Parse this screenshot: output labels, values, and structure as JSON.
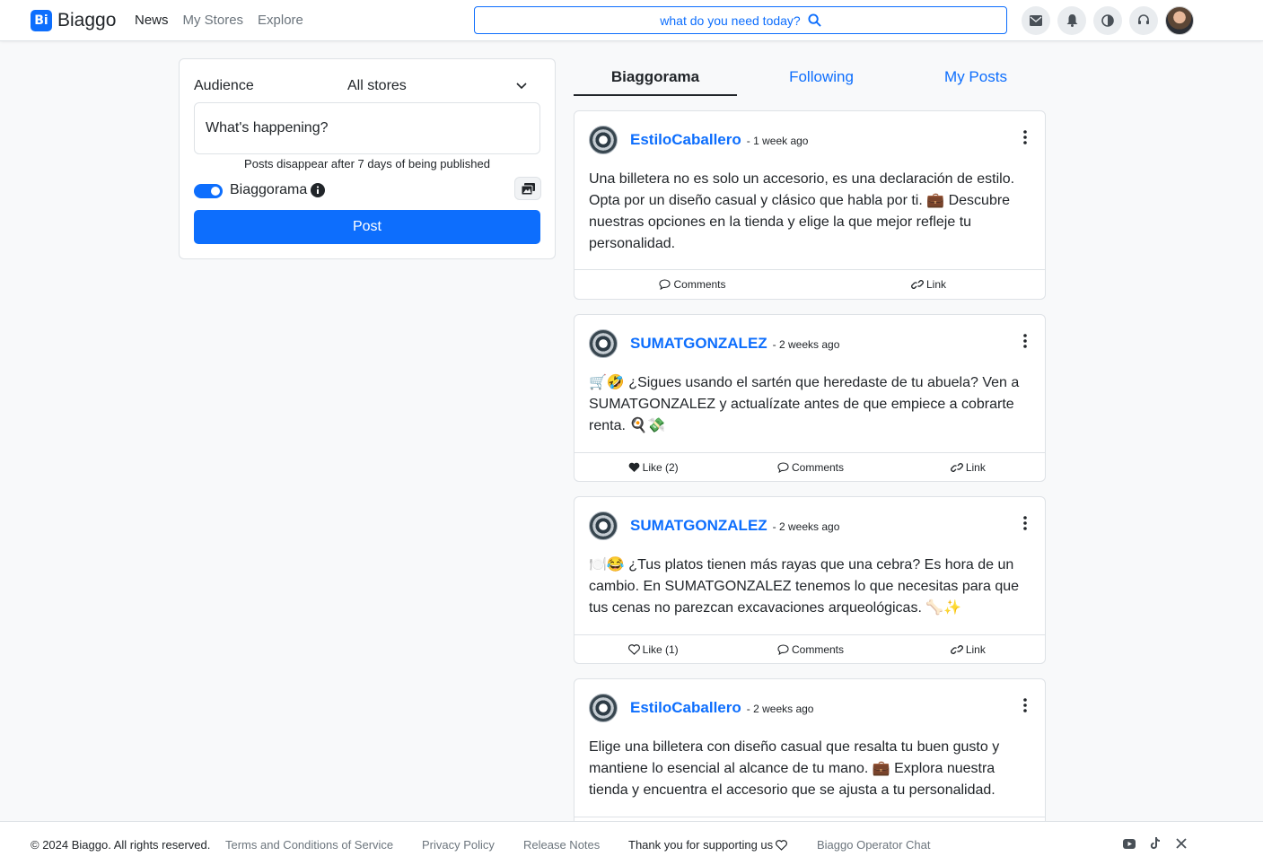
{
  "header": {
    "brand_logo": "Bi",
    "brand_name": "Biaggo",
    "nav": [
      "News",
      "My Stores",
      "Explore"
    ],
    "search_placeholder": "what do you need today?"
  },
  "composer": {
    "audience_label": "Audience",
    "audience_value": "All stores",
    "placeholder": "What's happening?",
    "disappear_note": "Posts disappear after 7 days of being published",
    "toggle_label": "Biaggorama",
    "toggle_on": true,
    "post_button": "Post"
  },
  "tabs": [
    "Biaggorama",
    "Following",
    "My Posts"
  ],
  "posts": [
    {
      "author": "EstiloCaballero",
      "time": "- 1 week ago",
      "body": "Una billetera no es solo un accesorio, es una declaración de estilo. Opta por un diseño casual y clásico que habla por ti. 💼 Descubre nuestras opciones en la tienda y elige la que mejor refleje tu personalidad.",
      "actions": [
        "Comments",
        "Link"
      ]
    },
    {
      "author": "SUMATGONZALEZ",
      "time": "- 2 weeks ago",
      "body": "🛒🤣 ¿Sigues usando el sartén que heredaste de tu abuela? Ven a SUMATGONZALEZ y actualízate antes de que empiece a cobrarte renta. 🍳💸",
      "actions": [
        "Like (2)",
        "Comments",
        "Link"
      ],
      "liked": true
    },
    {
      "author": "SUMATGONZALEZ",
      "time": "- 2 weeks ago",
      "body": "🍽️😂 ¿Tus platos tienen más rayas que una cebra? Es hora de un cambio. En SUMATGONZALEZ tenemos lo que necesitas para que tus cenas no parezcan excavaciones arqueológicas. 🦴✨",
      "actions": [
        "Like (1)",
        "Comments",
        "Link"
      ],
      "liked": false
    },
    {
      "author": "EstiloCaballero",
      "time": "- 2 weeks ago",
      "body": "Elige una billetera con diseño casual que resalta tu buen gusto y mantiene lo esencial al alcance de tu mano. 💼 Explora nuestra tienda y encuentra el accesorio que se ajusta a tu personalidad."
    }
  ],
  "footer": {
    "copyright": "© 2024 Biaggo. All rights reserved.",
    "terms": "Terms and Conditions of Service",
    "privacy": "Privacy Policy",
    "release": "Release Notes",
    "thanks": "Thank you for supporting us",
    "chat": "Biaggo Operator Chat"
  },
  "colors": {
    "accent": "#0d6efd",
    "muted": "#6c757d",
    "border": "#dee2e6"
  }
}
